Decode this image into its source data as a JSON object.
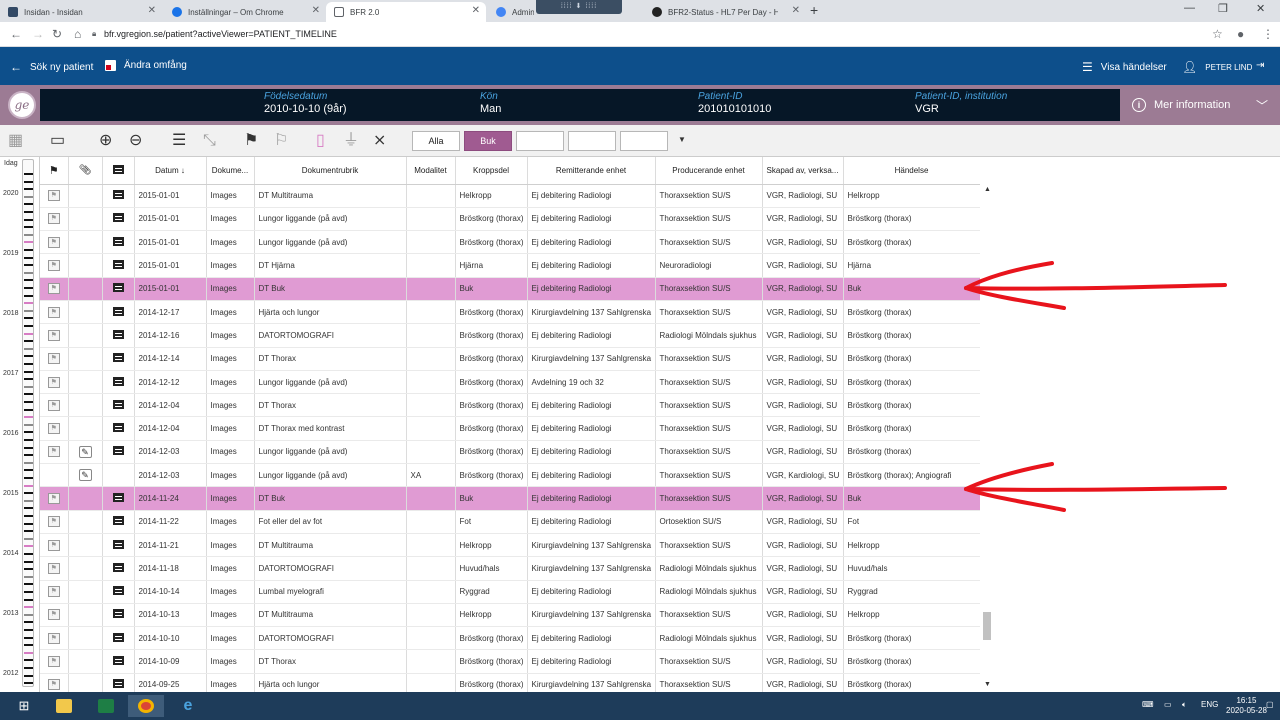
{
  "browser": {
    "tabs": [
      {
        "label": "Insidan - Insidan",
        "active": false,
        "color": "#334a66"
      },
      {
        "label": "Inställningar – Om Chrome",
        "active": false,
        "color": "#1a73e8"
      },
      {
        "label": "BFR 2.0",
        "active": true,
        "color": "#5f6368"
      },
      {
        "label": "Admin P",
        "active": false,
        "color": "#4285f4"
      },
      {
        "label": "BFR2-Status - HL7 Per Day - He:",
        "active": false,
        "color": "#222222"
      }
    ],
    "url": "bfr.vgregion.se/patient?activeViewer=PATIENT_TIMELINE"
  },
  "app_header": {
    "search_patient": "Sök ny patient",
    "change_scope": "Ändra omfång",
    "show_events": "Visa händelser",
    "user": "PETER LIND"
  },
  "patient": {
    "birthdate_label": "Födelsedatum",
    "birthdate_value": "2010-10-10 (9år)",
    "sex_label": "Kön",
    "sex_value": "Man",
    "id_label": "Patient-ID",
    "id_value": "201010101010",
    "inst_label": "Patient-ID, institution",
    "inst_value": "VGR",
    "more_info": "Mer information"
  },
  "filters": [
    "Alla",
    "Buk",
    "",
    "",
    ""
  ],
  "filter_selected": "Buk",
  "columns": [
    "",
    "",
    "",
    "Datum",
    "Dokume...",
    "Dokumentrubrik",
    "Modalitet",
    "Kroppsdel",
    "Remitterande enhet",
    "Producerande enhet",
    "Skapad av, verksa...",
    "Händelse"
  ],
  "rows": [
    {
      "date": "2015-01-01",
      "type": "Images",
      "title": "DT Multitrauma",
      "mod": "",
      "body": "Helkropp",
      "ref": "Ej debitering Radiologi",
      "prod": "Thoraxsektion SU/S",
      "created": "VGR, Radiologi, SU",
      "event": "Helkropp",
      "hl": false,
      "clip": false,
      "flag": true,
      "doc": true
    },
    {
      "date": "2015-01-01",
      "type": "Images",
      "title": "Lungor liggande (på avd)",
      "mod": "",
      "body": "Bröstkorg (thorax)",
      "ref": "Ej debitering Radiologi",
      "prod": "Thoraxsektion SU/S",
      "created": "VGR, Radiologi, SU",
      "event": "Bröstkorg (thorax)",
      "hl": false,
      "clip": false,
      "flag": true,
      "doc": true
    },
    {
      "date": "2015-01-01",
      "type": "Images",
      "title": "Lungor liggande (på avd)",
      "mod": "",
      "body": "Bröstkorg (thorax)",
      "ref": "Ej debitering Radiologi",
      "prod": "Thoraxsektion SU/S",
      "created": "VGR, Radiologi, SU",
      "event": "Bröstkorg (thorax)",
      "hl": false,
      "clip": false,
      "flag": true,
      "doc": true
    },
    {
      "date": "2015-01-01",
      "type": "Images",
      "title": "DT Hjärna",
      "mod": "",
      "body": "Hjärna",
      "ref": "Ej debitering Radiologi",
      "prod": "Neuroradiologi",
      "created": "VGR, Radiologi, SU",
      "event": "Hjärna",
      "hl": false,
      "clip": false,
      "flag": true,
      "doc": true
    },
    {
      "date": "2015-01-01",
      "type": "Images",
      "title": "DT Buk",
      "mod": "",
      "body": "Buk",
      "ref": "Ej debitering Radiologi",
      "prod": "Thoraxsektion SU/S",
      "created": "VGR, Radiologi, SU",
      "event": "Buk",
      "hl": true,
      "clip": false,
      "flag": true,
      "doc": true
    },
    {
      "date": "2014-12-17",
      "type": "Images",
      "title": "Hjärta och lungor",
      "mod": "",
      "body": "Bröstkorg (thorax)",
      "ref": "Kirurgiavdelning 137 Sahlgrenska",
      "prod": "Thoraxsektion SU/S",
      "created": "VGR, Radiologi, SU",
      "event": "Bröstkorg (thorax)",
      "hl": false,
      "clip": false,
      "flag": true,
      "doc": true
    },
    {
      "date": "2014-12-16",
      "type": "Images",
      "title": "DATORTOMOGRAFI",
      "mod": "",
      "body": "Bröstkorg (thorax)",
      "ref": "Ej debitering Radiologi",
      "prod": "Radiologi Mölndals sjukhus",
      "created": "VGR, Radiologi, SU",
      "event": "Bröstkorg (thorax)",
      "hl": false,
      "clip": false,
      "flag": true,
      "doc": true
    },
    {
      "date": "2014-12-14",
      "type": "Images",
      "title": "DT Thorax",
      "mod": "",
      "body": "Bröstkorg (thorax)",
      "ref": "Kirurgiavdelning 137 Sahlgrenska",
      "prod": "Thoraxsektion SU/S",
      "created": "VGR, Radiologi, SU",
      "event": "Bröstkorg (thorax)",
      "hl": false,
      "clip": false,
      "flag": true,
      "doc": true
    },
    {
      "date": "2014-12-12",
      "type": "Images",
      "title": "Lungor liggande (på avd)",
      "mod": "",
      "body": "Bröstkorg (thorax)",
      "ref": "Avdelning 19 och 32",
      "prod": "Thoraxsektion SU/S",
      "created": "VGR, Radiologi, SU",
      "event": "Bröstkorg (thorax)",
      "hl": false,
      "clip": false,
      "flag": true,
      "doc": true
    },
    {
      "date": "2014-12-04",
      "type": "Images",
      "title": "DT Thorax",
      "mod": "",
      "body": "Bröstkorg (thorax)",
      "ref": "Ej debitering Radiologi",
      "prod": "Thoraxsektion SU/S",
      "created": "VGR, Radiologi, SU",
      "event": "Bröstkorg (thorax)",
      "hl": false,
      "clip": false,
      "flag": true,
      "doc": true
    },
    {
      "date": "2014-12-04",
      "type": "Images",
      "title": "DT Thorax med kontrast",
      "mod": "",
      "body": "Bröstkorg (thorax)",
      "ref": "Ej debitering Radiologi",
      "prod": "Thoraxsektion SU/S",
      "created": "VGR, Radiologi, SU",
      "event": "Bröstkorg (thorax)",
      "hl": false,
      "clip": false,
      "flag": true,
      "doc": true
    },
    {
      "date": "2014-12-03",
      "type": "Images",
      "title": "Lungor liggande (på avd)",
      "mod": "",
      "body": "Bröstkorg (thorax)",
      "ref": "Ej debitering Radiologi",
      "prod": "Thoraxsektion SU/S",
      "created": "VGR, Radiologi, SU",
      "event": "Bröstkorg (thorax)",
      "hl": false,
      "clip": true,
      "flag": true,
      "doc": true
    },
    {
      "date": "2014-12-03",
      "type": "Images",
      "title": "Lungor liggande (på avd)",
      "mod": "XA",
      "body": "Bröstkorg (thorax)",
      "ref": "Ej debitering Radiologi",
      "prod": "Thoraxsektion SU/S",
      "created": "VGR, Kardiologi, SU",
      "event": "Bröstkorg (thorax); Angiografi",
      "hl": false,
      "clip": true,
      "flag": false,
      "doc": false
    },
    {
      "date": "2014-11-24",
      "type": "Images",
      "title": "DT Buk",
      "mod": "",
      "body": "Buk",
      "ref": "Ej debitering Radiologi",
      "prod": "Thoraxsektion SU/S",
      "created": "VGR, Radiologi, SU",
      "event": "Buk",
      "hl": true,
      "clip": false,
      "flag": true,
      "doc": true
    },
    {
      "date": "2014-11-22",
      "type": "Images",
      "title": "Fot eller del av fot",
      "mod": "",
      "body": "Fot",
      "ref": "Ej debitering Radiologi",
      "prod": "Ortosektion SU/S",
      "created": "VGR, Radiologi, SU",
      "event": "Fot",
      "hl": false,
      "clip": false,
      "flag": true,
      "doc": true
    },
    {
      "date": "2014-11-21",
      "type": "Images",
      "title": "DT Multitrauma",
      "mod": "",
      "body": "Helkropp",
      "ref": "Kirurgiavdelning 137 Sahlgrenska",
      "prod": "Thoraxsektion SU/S",
      "created": "VGR, Radiologi, SU",
      "event": "Helkropp",
      "hl": false,
      "clip": false,
      "flag": true,
      "doc": true
    },
    {
      "date": "2014-11-18",
      "type": "Images",
      "title": "DATORTOMOGRAFI",
      "mod": "",
      "body": "Huvud/hals",
      "ref": "Kirurgiavdelning 137 Sahlgrenska",
      "prod": "Radiologi Mölndals sjukhus",
      "created": "VGR, Radiologi, SU",
      "event": "Huvud/hals",
      "hl": false,
      "clip": false,
      "flag": true,
      "doc": true
    },
    {
      "date": "2014-10-14",
      "type": "Images",
      "title": "Lumbal myelografi",
      "mod": "",
      "body": "Ryggrad",
      "ref": "Ej debitering Radiologi",
      "prod": "Radiologi Mölndals sjukhus",
      "created": "VGR, Radiologi, SU",
      "event": "Ryggrad",
      "hl": false,
      "clip": false,
      "flag": true,
      "doc": true
    },
    {
      "date": "2014-10-13",
      "type": "Images",
      "title": "DT Multitrauma",
      "mod": "",
      "body": "Helkropp",
      "ref": "Kirurgiavdelning 137 Sahlgrenska",
      "prod": "Thoraxsektion SU/S",
      "created": "VGR, Radiologi, SU",
      "event": "Helkropp",
      "hl": false,
      "clip": false,
      "flag": true,
      "doc": true
    },
    {
      "date": "2014-10-10",
      "type": "Images",
      "title": "DATORTOMOGRAFI",
      "mod": "",
      "body": "Bröstkorg (thorax)",
      "ref": "Ej debitering Radiologi",
      "prod": "Radiologi Mölndals sjukhus",
      "created": "VGR, Radiologi, SU",
      "event": "Bröstkorg (thorax)",
      "hl": false,
      "clip": false,
      "flag": true,
      "doc": true
    },
    {
      "date": "2014-10-09",
      "type": "Images",
      "title": "DT Thorax",
      "mod": "",
      "body": "Bröstkorg (thorax)",
      "ref": "Ej debitering Radiologi",
      "prod": "Thoraxsektion SU/S",
      "created": "VGR, Radiologi, SU",
      "event": "Bröstkorg (thorax)",
      "hl": false,
      "clip": false,
      "flag": true,
      "doc": true
    },
    {
      "date": "2014-09-25",
      "type": "Images",
      "title": "Hjärta och lungor",
      "mod": "",
      "body": "Bröstkorg (thorax)",
      "ref": "Kirurgiavdelning 137 Sahlgrenska",
      "prod": "Thoraxsektion SU/S",
      "created": "VGR, Radiologi, SU",
      "event": "Bröstkorg (thorax)",
      "hl": false,
      "clip": false,
      "flag": true,
      "doc": true
    }
  ],
  "timeline": {
    "head": "Idag",
    "years": [
      "2020",
      "2019",
      "2018",
      "2017",
      "2016",
      "2015",
      "2014",
      "2013",
      "2012"
    ]
  },
  "taskbar": {
    "lang": "ENG",
    "time": "16:15",
    "date": "2020-05-28"
  },
  "colors": {
    "header": "#0d4f8b",
    "banner": "#9c7b94",
    "highlight_row": "#e09bd3",
    "selected_filter": "#a05b91",
    "annotation": "#e8141c"
  }
}
